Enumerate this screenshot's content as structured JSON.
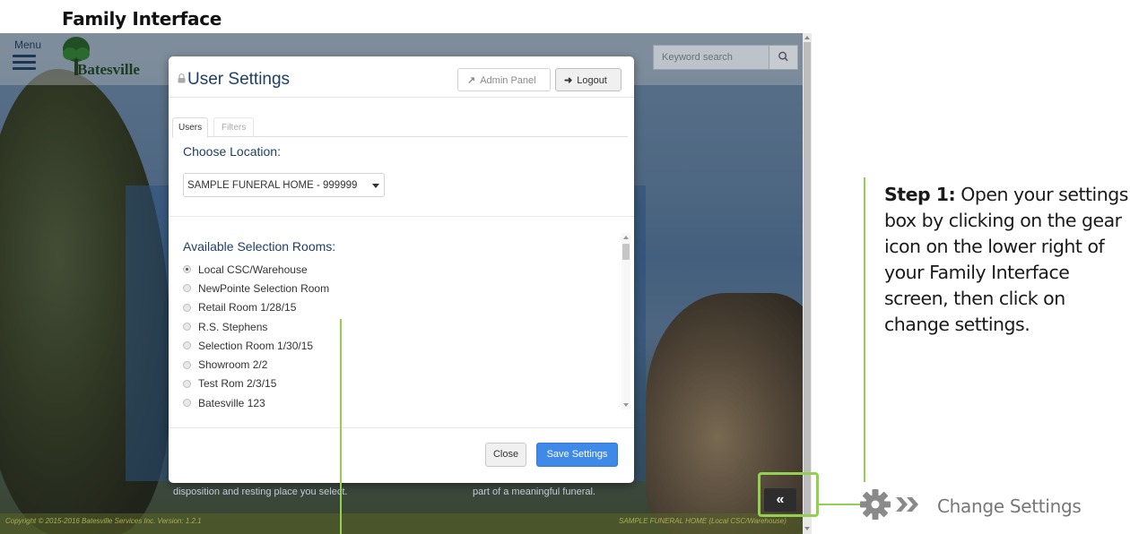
{
  "doc_title": "Family Interface",
  "app": {
    "menu_label": "Menu",
    "logo_text": "Batesville",
    "search_placeholder": "Keyword search",
    "copyright": "Copyright © 2015-2016 Batesville Services Inc. Version: 1.2.1",
    "footer_right": "SAMPLE FUNERAL HOME (Local CSC/Warehouse)",
    "background_text_left": "disposition and resting place you select.",
    "background_text_right": "part of a meaningful funeral.",
    "collapse_glyph": "«"
  },
  "modal": {
    "title": "User Settings",
    "admin_panel_label": "Admin Panel",
    "logout_label": "Logout",
    "tabs": [
      "Users",
      "Filters"
    ],
    "choose_location_label": "Choose Location:",
    "selected_location": "SAMPLE FUNERAL HOME - 999999",
    "available_rooms_label": "Available Selection Rooms:",
    "rooms": [
      "Local CSC/Warehouse",
      "NewPointe Selection Room",
      "Retail Room 1/28/15",
      "R.S. Stephens",
      "Selection Room 1/30/15",
      "Showroom 2/2",
      "Test Rom 2/3/15",
      "Batesville 123"
    ],
    "selected_room": "Local CSC/Warehouse",
    "close_label": "Close",
    "save_label": "Save Settings"
  },
  "annotation": {
    "step_bold": "Step 1:",
    "step_text": " Open your settings box by clicking on the gear icon on the lower right of your Family Interface screen, then click on change settings.",
    "change_settings_label": "Change Settings",
    "highlight_color": "#92d050"
  }
}
